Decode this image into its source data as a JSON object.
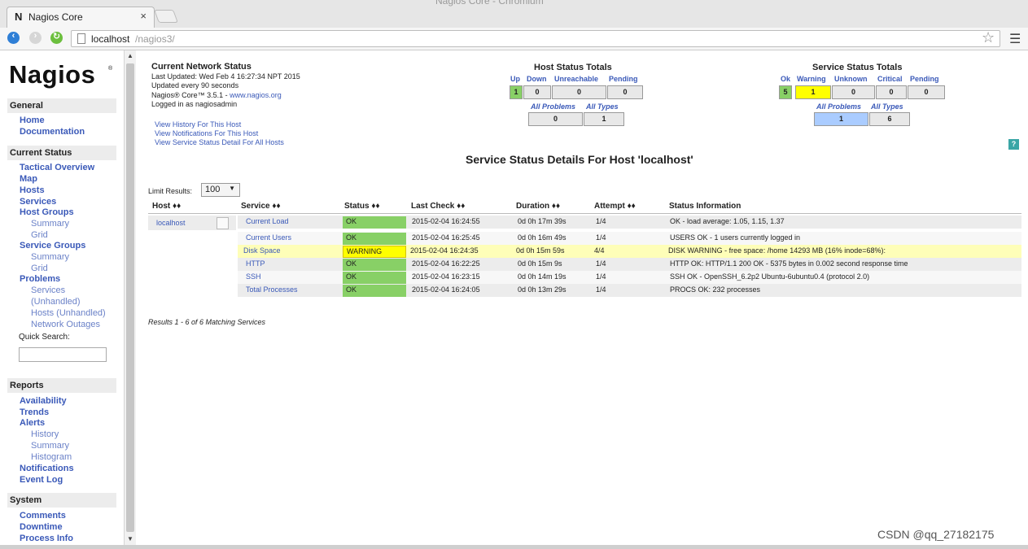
{
  "browser": {
    "window_title": "Nagios Core - Chromium",
    "tab_title": "Nagios Core",
    "tab_favicon": "N",
    "url_host": "localhost",
    "url_path": "/nagios3/",
    "icons": [
      "back-icon",
      "forward-icon",
      "reload-icon",
      "star-icon",
      "menu-icon",
      "close-icon"
    ]
  },
  "sidebar": {
    "logo": "Nagios",
    "logo_mark": "®",
    "general": {
      "header": "General",
      "items": [
        "Home",
        "Documentation"
      ]
    },
    "current_status": {
      "header": "Current Status",
      "items": [
        "Tactical Overview",
        "Map",
        "Hosts",
        "Services",
        "Host Groups",
        "Summary",
        "Grid",
        "Service Groups",
        "Summary",
        "Grid",
        "Problems",
        "Services",
        "(Unhandled)",
        "Hosts (Unhandled)",
        "Network Outages"
      ],
      "quick_search_label": "Quick Search:"
    },
    "reports": {
      "header": "Reports",
      "items": [
        "Availability",
        "Trends",
        "Alerts",
        "History",
        "Summary",
        "Histogram",
        "Notifications",
        "Event Log"
      ]
    },
    "system": {
      "header": "System",
      "items": [
        "Comments",
        "Downtime",
        "Process Info"
      ]
    }
  },
  "info": {
    "title": "Current Network Status",
    "last_updated": "Last Updated: Wed Feb 4 16:27:34 NPT 2015",
    "update_interval": "Updated every 90 seconds",
    "version": "Nagios® Core™ 3.5.1 - ",
    "version_link": "www.nagios.org",
    "logged_in": "Logged in as nagiosadmin",
    "links": [
      "View History For This Host",
      "View Notifications For This Host",
      "View Service Status Detail For All Hosts"
    ]
  },
  "host_totals": {
    "title": "Host Status Totals",
    "headers": [
      "Up",
      "Down",
      "Unreachable",
      "Pending"
    ],
    "values": [
      "1",
      "0",
      "0",
      "0"
    ],
    "sub_headers": [
      "All Problems",
      "All Types"
    ],
    "sub_values": [
      "0",
      "1"
    ]
  },
  "service_totals": {
    "title": "Service Status Totals",
    "headers": [
      "Ok",
      "Warning",
      "Unknown",
      "Critical",
      "Pending"
    ],
    "values": [
      "5",
      "1",
      "0",
      "0",
      "0"
    ],
    "sub_headers": [
      "All Problems",
      "All Types"
    ],
    "sub_values": [
      "1",
      "6"
    ]
  },
  "help_icon": "?",
  "details": {
    "title": "Service Status Details For Host 'localhost'",
    "limit_label": "Limit Results:",
    "limit_value": "100",
    "sort_glyph": "♦♦",
    "columns": [
      "Host",
      "Service",
      "Status",
      "Last Check",
      "Duration",
      "Attempt",
      "Status Information"
    ],
    "host": "localhost",
    "rows": [
      {
        "service": "Current Load",
        "status": "OK",
        "last_check": "2015-02-04 16:24:55",
        "duration": "0d 0h 17m 39s",
        "attempt": "1/4",
        "info": "OK - load average: 1.05, 1.15, 1.37"
      },
      {
        "service": "Current Users",
        "status": "OK",
        "last_check": "2015-02-04 16:25:45",
        "duration": "0d 0h 16m 49s",
        "attempt": "1/4",
        "info": "USERS OK - 1 users currently logged in"
      },
      {
        "service": "Disk Space",
        "status": "WARNING",
        "last_check": "2015-02-04 16:24:35",
        "duration": "0d 0h 15m 59s",
        "attempt": "4/4",
        "info": "DISK WARNING - free space: /home 14293 MB (16% inode=68%):"
      },
      {
        "service": "HTTP",
        "status": "OK",
        "last_check": "2015-02-04 16:22:25",
        "duration": "0d 0h 15m 9s",
        "attempt": "1/4",
        "info": "HTTP OK: HTTP/1.1 200 OK - 5375 bytes in 0.002 second response time"
      },
      {
        "service": "SSH",
        "status": "OK",
        "last_check": "2015-02-04 16:23:15",
        "duration": "0d 0h 14m 19s",
        "attempt": "1/4",
        "info": "SSH OK - OpenSSH_6.2p2 Ubuntu-6ubuntu0.4 (protocol 2.0)"
      },
      {
        "service": "Total Processes",
        "status": "OK",
        "last_check": "2015-02-04 16:24:05",
        "duration": "0d 0h 13m 29s",
        "attempt": "1/4",
        "info": "PROCS OK: 232 processes"
      }
    ],
    "results_text": "Results 1 - 6 of 6 Matching Services"
  },
  "colors": {
    "ok": "#88d066",
    "warning": "#ffff00",
    "link": "#3a59b8",
    "all_problems_hl": "#aaccff"
  },
  "watermark": "CSDN @qq_27182175"
}
